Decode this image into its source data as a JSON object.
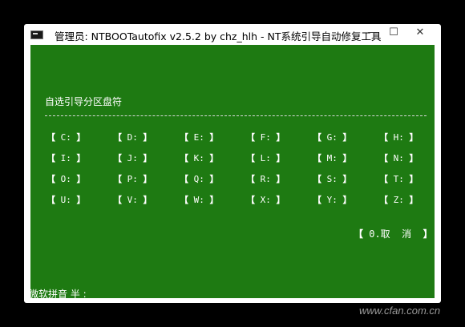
{
  "window": {
    "title": "管理员:  NTBOOTautofix v2.5.2 by chz_hlh - NT系统引导自动修复工具",
    "minimize": "—",
    "maximize": "☐",
    "close": "✕"
  },
  "console": {
    "prompt": "自选引导分区盘符",
    "drives": [
      "C:",
      "D:",
      "E:",
      "F:",
      "G:",
      "H:",
      "I:",
      "J:",
      "K:",
      "L:",
      "M:",
      "N:",
      "O:",
      "P:",
      "Q:",
      "R:",
      "S:",
      "T:",
      "U:",
      "V:",
      "W:",
      "X:",
      "Y:",
      "Z:"
    ],
    "cancel_label": "0.取  消",
    "ime_status": "微软拼音 半 :"
  },
  "watermark": "www.cfan.com.cn",
  "colors": {
    "console_bg": "#1e7a12",
    "console_fg": "#ffffff"
  }
}
